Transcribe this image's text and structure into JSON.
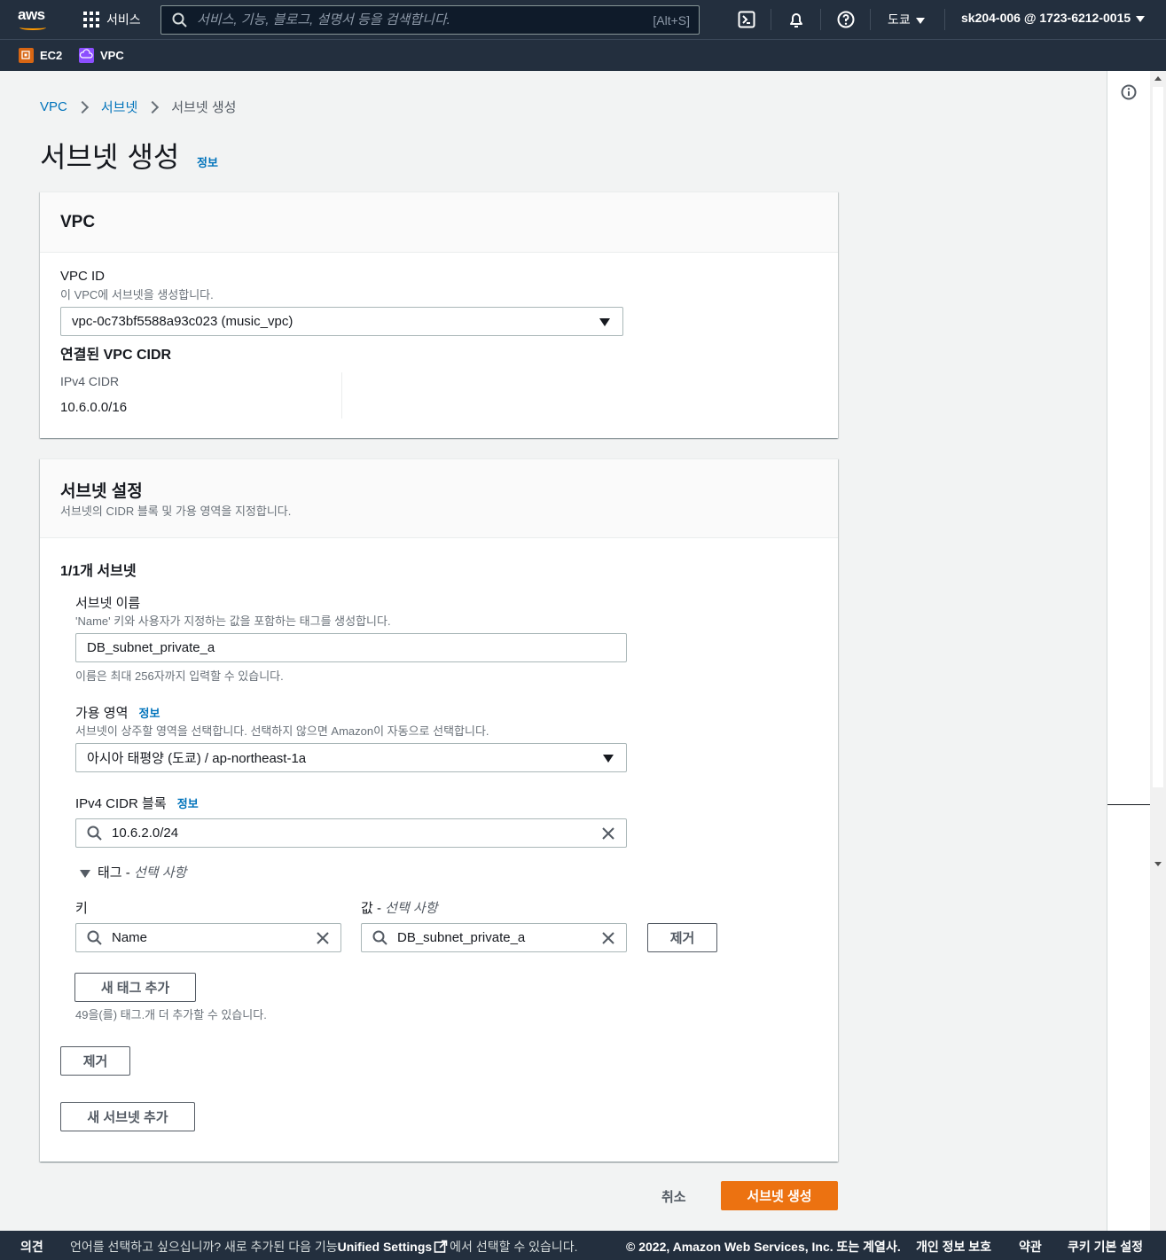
{
  "topnav": {
    "logo": "aws",
    "services_label": "서비스",
    "search_placeholder": "서비스, 기능, 블로그, 설명서 등을 검색합니다.",
    "search_shortcut": "[Alt+S]",
    "region": "도쿄",
    "account": "sk204-006 @ 1723-6212-0015"
  },
  "favorites": [
    {
      "label": "EC2",
      "icon": "ec2-icon",
      "color": "#d86613"
    },
    {
      "label": "VPC",
      "icon": "vpc-icon",
      "color": "#8c4fff"
    }
  ],
  "breadcrumb": [
    "VPC",
    "서브넷",
    "서브넷 생성"
  ],
  "page": {
    "title": "서브넷 생성",
    "info": "정보"
  },
  "vpc_section": {
    "header": "VPC",
    "vpc_id_label": "VPC ID",
    "vpc_id_desc": "이 VPC에 서브넷을 생성합니다.",
    "vpc_id_value": "vpc-0c73bf5588a93c023 (music_vpc)",
    "cidr_heading": "연결된 VPC CIDR",
    "ipv4_label": "IPv4 CIDR",
    "ipv4_value": "10.6.0.0/16"
  },
  "subnet_section": {
    "header": "서브넷 설정",
    "header_desc": "서브넷의 CIDR 블록 및 가용 영역을 지정합니다.",
    "subnet_count": "1/1개 서브넷",
    "name_label": "서브넷 이름",
    "name_desc": "'Name' 키와 사용자가 지정하는 값을 포함하는 태그를 생성합니다.",
    "name_value": "DB_subnet_private_a",
    "name_constraint": "이름은 최대 256자까지 입력할 수 있습니다.",
    "az_label": "가용 영역",
    "az_info": "정보",
    "az_desc": "서브넷이 상주할 영역을 선택합니다. 선택하지 않으면 Amazon이 자동으로 선택합니다.",
    "az_value": "아시아 태평양 (도쿄) / ap-northeast-1a",
    "cidr_label": "IPv4 CIDR 블록",
    "cidr_info": "정보",
    "cidr_value": "10.6.2.0/24",
    "tags_toggle": "태그",
    "tags_optional": "선택 사항",
    "key_label": "키",
    "value_label": "값",
    "value_optional": "선택 사항",
    "tag_key": "Name",
    "tag_value": "DB_subnet_private_a",
    "remove_tag": "제거",
    "add_tag": "새 태그 추가",
    "tag_limit": "49을(를) 태그.개 더 추가할 수 있습니다.",
    "remove_subnet": "제거",
    "add_subnet": "새 서브넷 추가"
  },
  "actions": {
    "cancel": "취소",
    "submit": "서브넷 생성"
  },
  "footer": {
    "feedback": "의견",
    "lang_prefix": "언어를 선택하고 싶으십니까? 새로 추가된 다음 기능",
    "unified": "Unified Settings",
    "lang_suffix": "에서 선택할 수 있습니다.",
    "copyright": "© 2022, Amazon Web Services, Inc. 또는 계열사.",
    "privacy": "개인 정보 보호",
    "terms": "약관",
    "cookies": "쿠키 기본 설정"
  },
  "colors": {
    "nav_bg": "#232f3e",
    "link": "#0073bb",
    "primary": "#ec7211"
  }
}
